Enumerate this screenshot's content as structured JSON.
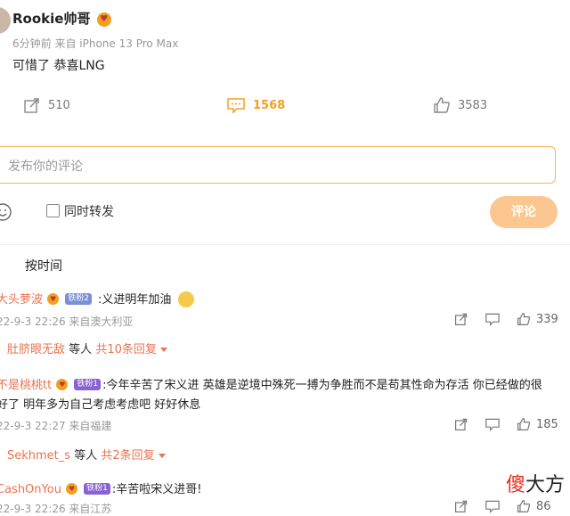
{
  "post": {
    "username": "Rookie帅哥",
    "time": "6分钟前",
    "source": "来自 iPhone 13 Pro Max",
    "text": "可惜了 恭喜LNG",
    "actions": {
      "share_count": "510",
      "comment_count": "1568",
      "like_count": "3583"
    }
  },
  "composer": {
    "placeholder": "发布你的评论",
    "forward_label": "同时转发",
    "submit_label": "评论"
  },
  "sort_label": "按时间",
  "comments": [
    {
      "author": "大头萝波",
      "vip": "铁粉2",
      "text": ":义进明年加油",
      "date": "22-9-3 22:26 来自澳大利亚",
      "like_count": "339",
      "reply_user": "肚脐眼无敌",
      "reply_mid": "等人",
      "reply_total": "共10条回复"
    },
    {
      "author": "不是桃桃tt",
      "vip": "铁粉1",
      "text_line1": ":今年辛苦了宋义进 英雄是逆境中殊死一搏为争胜而不是苟其性命为存活 你已经做的很",
      "text_line2": "好了 明年多为自己考虑考虑吧 好好休息",
      "date": "22-9-3 22:27 来自福建",
      "like_count": "185",
      "reply_user": "Sekhmet_s",
      "reply_mid": "等人",
      "reply_total": "共2条回复"
    },
    {
      "author": "CashOnYou",
      "vip": "铁粉1",
      "text": ":辛苦啦宋义进哥!",
      "date": "22-9-3 22:26 来自江苏",
      "like_count": "86"
    }
  ],
  "watermark": {
    "part1": "傻",
    "part2": "大方"
  },
  "colors": {
    "accent": "#f0a020",
    "author": "#eb7350",
    "submit": "#fbc690"
  }
}
